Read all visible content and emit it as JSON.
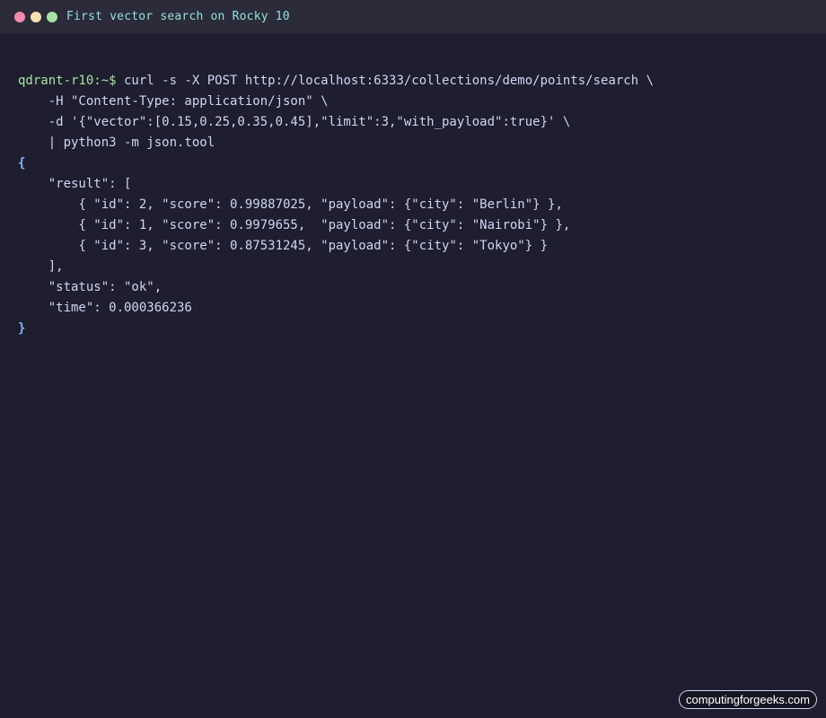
{
  "window": {
    "title": "First vector search on Rocky 10",
    "controls": {
      "close_color": "#f38ba8",
      "minimize_color": "#f9e2af",
      "maximize_color": "#a6e3a1"
    }
  },
  "terminal": {
    "prompt": "qdrant-r10:~$",
    "lines": [
      " curl -s -X POST http://localhost:6333/collections/demo/points/search \\",
      "    -H \"Content-Type: application/json\" \\",
      "    -d '{\"vector\":[0.15,0.25,0.35,0.45],\"limit\":3,\"with_payload\":true}' \\",
      "    | python3 -m json.tool",
      "{",
      "    \"result\": [",
      "        { \"id\": 2, \"score\": 0.99887025, \"payload\": {\"city\": \"Berlin\"} },",
      "        { \"id\": 1, \"score\": 0.9979655,  \"payload\": {\"city\": \"Nairobi\"} },",
      "        { \"id\": 3, \"score\": 0.87531245, \"payload\": {\"city\": \"Tokyo\"} }",
      "    ],",
      "    \"status\": \"ok\",",
      "    \"time\": 0.000366236",
      "}"
    ]
  },
  "watermark": "computingforgeeks.com",
  "colors": {
    "background": "#1e1e2e",
    "titlebar": "#2b2b3a",
    "title_text": "#94e2d5",
    "prompt": "#a6e3a1",
    "text": "#cdd6f4",
    "brace": "#89b4fa"
  }
}
